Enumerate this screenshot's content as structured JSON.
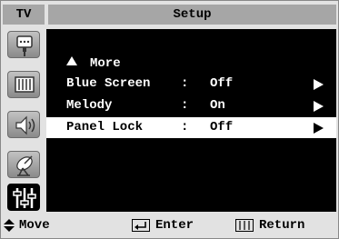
{
  "header": {
    "tv_label": "TV",
    "title": "Setup"
  },
  "sidebar": {
    "icons": [
      {
        "name": "input-icon"
      },
      {
        "name": "picture-icon"
      },
      {
        "name": "sound-icon"
      },
      {
        "name": "channel-icon"
      },
      {
        "name": "setup-icon",
        "active": true
      }
    ]
  },
  "menu": {
    "more_label": "More",
    "items": [
      {
        "label": "Blue Screen",
        "separator": ":",
        "value": "Off"
      },
      {
        "label": "Melody",
        "separator": ":",
        "value": "On"
      },
      {
        "label": "Panel Lock",
        "separator": ":",
        "value": "Off",
        "selected": true
      }
    ]
  },
  "footer": {
    "move": "Move",
    "enter": "Enter",
    "return": "Return"
  }
}
